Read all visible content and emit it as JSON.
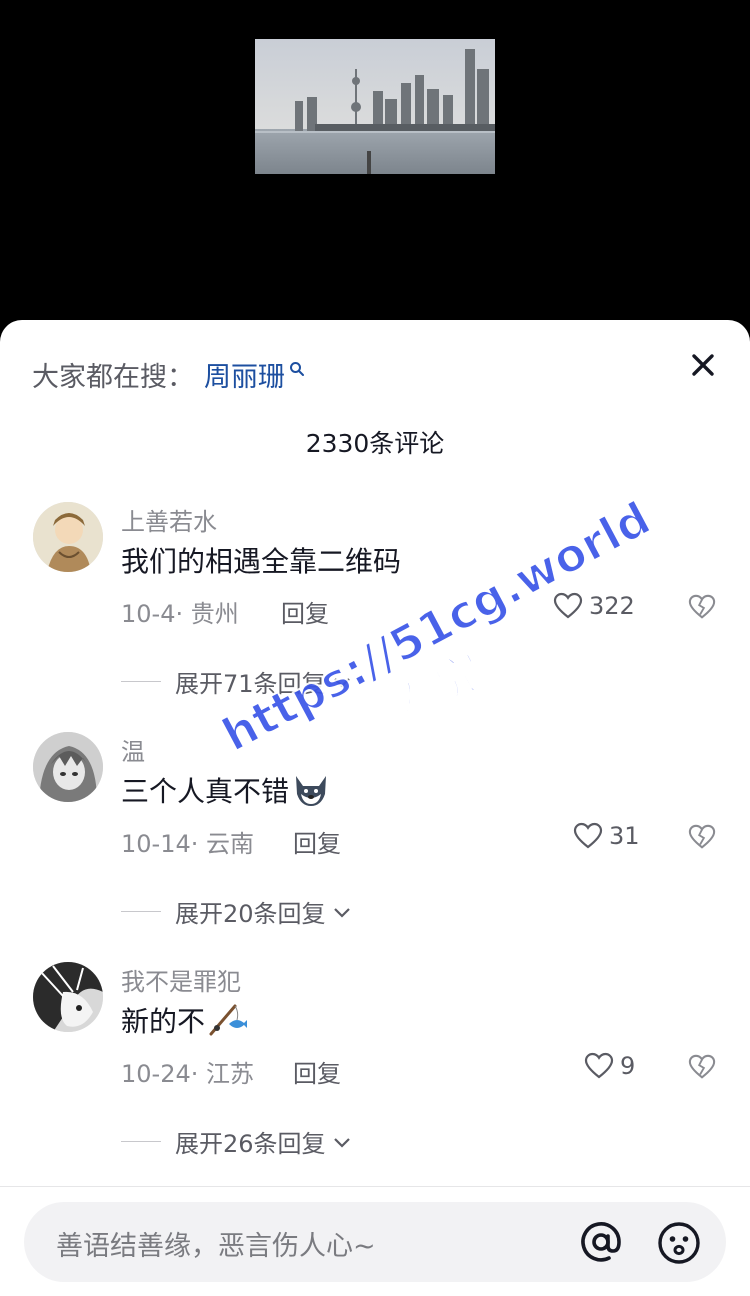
{
  "hot_search": {
    "prefix": "大家都在搜：",
    "term": "周丽珊"
  },
  "comment_count": "2330条评论",
  "comments": [
    {
      "user": "上善若水",
      "text": "我们的相遇全靠二维码",
      "date_location": "10-4· 贵州",
      "reply_label": "回复",
      "likes": "322",
      "expand_label": "展开71条回复"
    },
    {
      "user": "温",
      "text": "三个人真不错",
      "emoji": "wolf-face",
      "date_location": "10-14· 云南",
      "reply_label": "回复",
      "likes": "31",
      "expand_label": "展开20条回复"
    },
    {
      "user": "我不是罪犯",
      "text": "新的不",
      "emoji": "fishing-pole",
      "date_location": "10-24· 江苏",
      "reply_label": "回复",
      "likes": "9",
      "expand_label": "展开26条回复"
    }
  ],
  "input": {
    "placeholder": "善语结善缘，恶言伤人心~"
  },
  "watermark": {
    "line1": "https://51cg.world",
    "line2": "看完整版"
  },
  "icons": {
    "hot_search": "search-icon",
    "close": "close-icon",
    "like": "heart-icon",
    "dislike": "broken-heart-icon",
    "expand": "chevron-down-icon",
    "mention": "at-icon",
    "emoji": "smiley-icon"
  },
  "colors": {
    "accent_link": "#1d4fa0",
    "watermark": "#3a55e8",
    "sheet_bg": "#ffffff",
    "page_bg": "#000000"
  }
}
